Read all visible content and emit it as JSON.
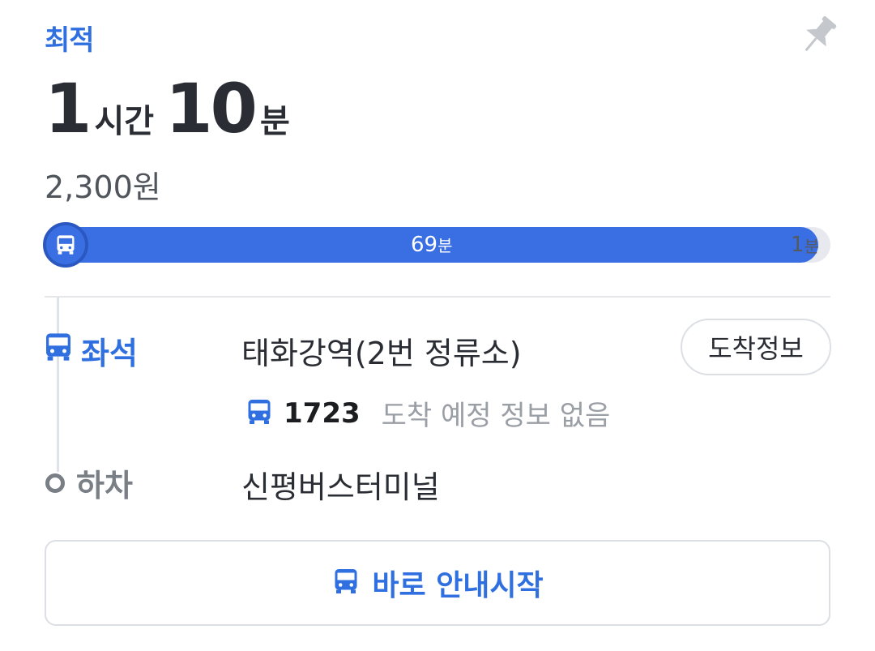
{
  "route": {
    "badge": "최적",
    "hours": "1",
    "hours_unit": "시간",
    "minutes": "10",
    "minutes_unit": "분",
    "fare": "2,300원"
  },
  "progress": {
    "bus_minutes": "69",
    "walk_minutes": "1",
    "unit": "분",
    "bus_fraction": 0.985,
    "bus_color": "#3a6ee3",
    "track_color": "#e7e9ee"
  },
  "boarding": {
    "label": "좌석",
    "stop": "태화강역(2번 정류소)",
    "arrival_button": "도착정보",
    "bus_number": "1723",
    "arrival_status": "도착 예정 정보 없음"
  },
  "alighting": {
    "label": "하차",
    "stop": "신평버스터미널"
  },
  "actions": {
    "start_label": "바로 안내시작"
  },
  "icons": {
    "pin": "pin-icon",
    "bus": "bus-icon",
    "off_marker": "circle-marker-icon"
  },
  "colors": {
    "accent": "#2f6fe0",
    "text": "#2a2d33",
    "muted": "#9a9ea5"
  }
}
